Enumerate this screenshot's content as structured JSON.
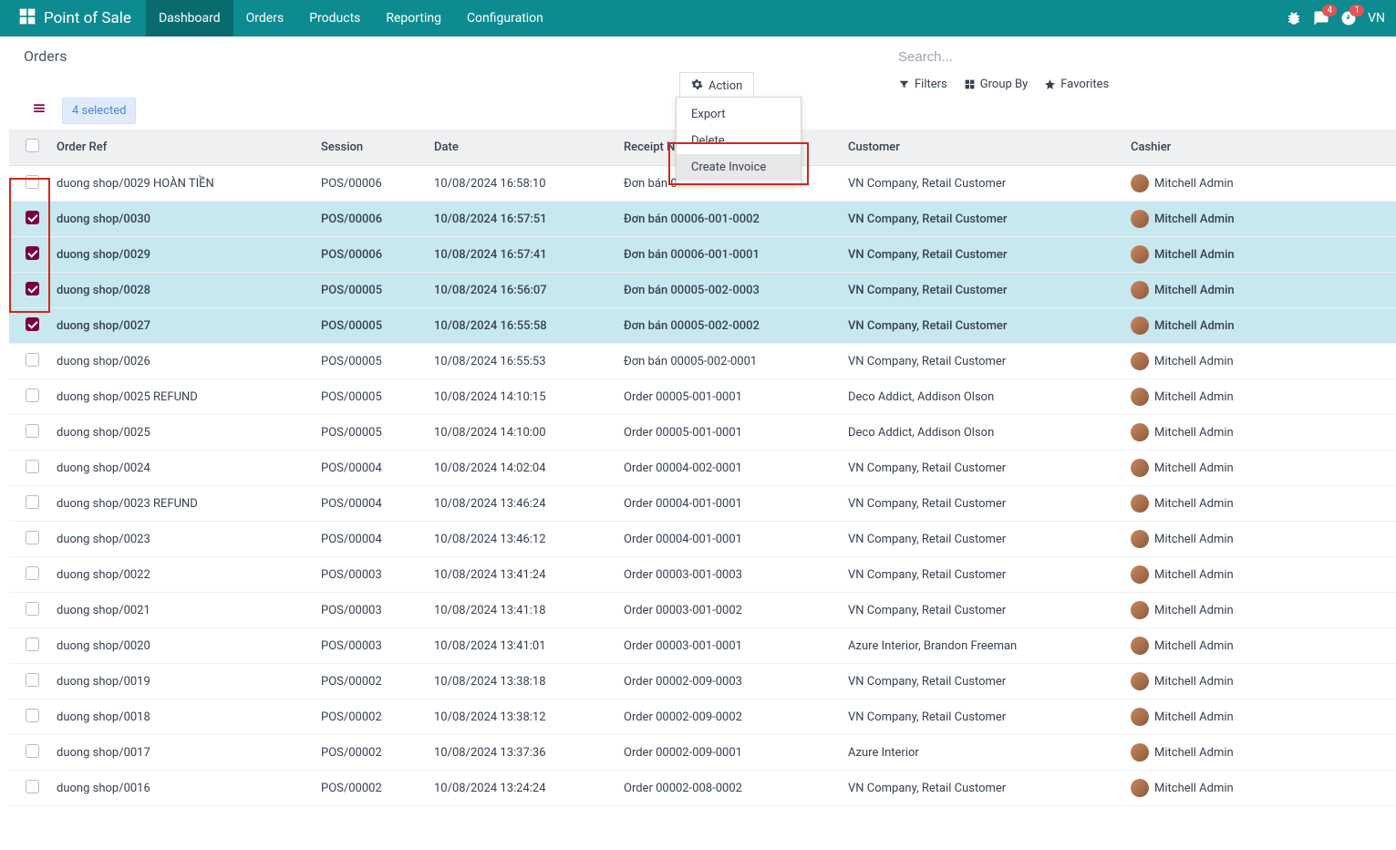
{
  "navbar": {
    "brand": "Point of Sale",
    "menu": [
      "Dashboard",
      "Orders",
      "Products",
      "Reporting",
      "Configuration"
    ],
    "active_index": 0,
    "messages_badge": "4",
    "activities_badge": "1",
    "user_abbr": "VN"
  },
  "breadcrumb": {
    "title": "Orders"
  },
  "search": {
    "placeholder": "Search..."
  },
  "controls": {
    "selected_label": "4 selected",
    "action_label": "Action",
    "filters_label": "Filters",
    "groupby_label": "Group By",
    "favorites_label": "Favorites"
  },
  "action_menu": {
    "items": [
      "Export",
      "Delete",
      "Create Invoice"
    ],
    "highlighted_index": 2
  },
  "table": {
    "headers": [
      "Order Ref",
      "Session",
      "Date",
      "Receipt Number",
      "Customer",
      "Cashier"
    ],
    "rows": [
      {
        "selected": false,
        "order": "duong shop/0029 HOÀN TIỀN",
        "session": "POS/00006",
        "date": "10/08/2024 16:58:10",
        "receipt": "Đơn bán 0",
        "customer": "VN Company, Retail Customer",
        "cashier": "Mitchell Admin"
      },
      {
        "selected": true,
        "order": "duong shop/0030",
        "session": "POS/00006",
        "date": "10/08/2024 16:57:51",
        "receipt": "Đơn bán 00006-001-0002",
        "customer": "VN Company, Retail Customer",
        "cashier": "Mitchell Admin"
      },
      {
        "selected": true,
        "order": "duong shop/0029",
        "session": "POS/00006",
        "date": "10/08/2024 16:57:41",
        "receipt": "Đơn bán 00006-001-0001",
        "customer": "VN Company, Retail Customer",
        "cashier": "Mitchell Admin"
      },
      {
        "selected": true,
        "order": "duong shop/0028",
        "session": "POS/00005",
        "date": "10/08/2024 16:56:07",
        "receipt": "Đơn bán 00005-002-0003",
        "customer": "VN Company, Retail Customer",
        "cashier": "Mitchell Admin"
      },
      {
        "selected": true,
        "order": "duong shop/0027",
        "session": "POS/00005",
        "date": "10/08/2024 16:55:58",
        "receipt": "Đơn bán 00005-002-0002",
        "customer": "VN Company, Retail Customer",
        "cashier": "Mitchell Admin"
      },
      {
        "selected": false,
        "order": "duong shop/0026",
        "session": "POS/00005",
        "date": "10/08/2024 16:55:53",
        "receipt": "Đơn bán 00005-002-0001",
        "customer": "VN Company, Retail Customer",
        "cashier": "Mitchell Admin"
      },
      {
        "selected": false,
        "order": "duong shop/0025 REFUND",
        "session": "POS/00005",
        "date": "10/08/2024 14:10:15",
        "receipt": "Order 00005-001-0001",
        "customer": "Deco Addict, Addison Olson",
        "cashier": "Mitchell Admin"
      },
      {
        "selected": false,
        "order": "duong shop/0025",
        "session": "POS/00005",
        "date": "10/08/2024 14:10:00",
        "receipt": "Order 00005-001-0001",
        "customer": "Deco Addict, Addison Olson",
        "cashier": "Mitchell Admin"
      },
      {
        "selected": false,
        "order": "duong shop/0024",
        "session": "POS/00004",
        "date": "10/08/2024 14:02:04",
        "receipt": "Order 00004-002-0001",
        "customer": "VN Company, Retail Customer",
        "cashier": "Mitchell Admin"
      },
      {
        "selected": false,
        "order": "duong shop/0023 REFUND",
        "session": "POS/00004",
        "date": "10/08/2024 13:46:24",
        "receipt": "Order 00004-001-0001",
        "customer": "VN Company, Retail Customer",
        "cashier": "Mitchell Admin"
      },
      {
        "selected": false,
        "order": "duong shop/0023",
        "session": "POS/00004",
        "date": "10/08/2024 13:46:12",
        "receipt": "Order 00004-001-0001",
        "customer": "VN Company, Retail Customer",
        "cashier": "Mitchell Admin"
      },
      {
        "selected": false,
        "order": "duong shop/0022",
        "session": "POS/00003",
        "date": "10/08/2024 13:41:24",
        "receipt": "Order 00003-001-0003",
        "customer": "VN Company, Retail Customer",
        "cashier": "Mitchell Admin"
      },
      {
        "selected": false,
        "order": "duong shop/0021",
        "session": "POS/00003",
        "date": "10/08/2024 13:41:18",
        "receipt": "Order 00003-001-0002",
        "customer": "VN Company, Retail Customer",
        "cashier": "Mitchell Admin"
      },
      {
        "selected": false,
        "order": "duong shop/0020",
        "session": "POS/00003",
        "date": "10/08/2024 13:41:01",
        "receipt": "Order 00003-001-0001",
        "customer": "Azure Interior, Brandon Freeman",
        "cashier": "Mitchell Admin"
      },
      {
        "selected": false,
        "order": "duong shop/0019",
        "session": "POS/00002",
        "date": "10/08/2024 13:38:18",
        "receipt": "Order 00002-009-0003",
        "customer": "VN Company, Retail Customer",
        "cashier": "Mitchell Admin"
      },
      {
        "selected": false,
        "order": "duong shop/0018",
        "session": "POS/00002",
        "date": "10/08/2024 13:38:12",
        "receipt": "Order 00002-009-0002",
        "customer": "VN Company, Retail Customer",
        "cashier": "Mitchell Admin"
      },
      {
        "selected": false,
        "order": "duong shop/0017",
        "session": "POS/00002",
        "date": "10/08/2024 13:37:36",
        "receipt": "Order 00002-009-0001",
        "customer": "Azure Interior",
        "cashier": "Mitchell Admin"
      },
      {
        "selected": false,
        "order": "duong shop/0016",
        "session": "POS/00002",
        "date": "10/08/2024 13:24:24",
        "receipt": "Order 00002-008-0002",
        "customer": "VN Company, Retail Customer",
        "cashier": "Mitchell Admin"
      }
    ]
  }
}
